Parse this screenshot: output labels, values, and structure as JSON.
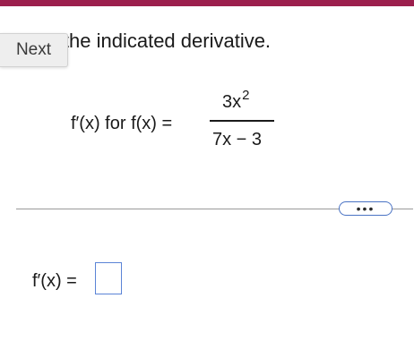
{
  "header": {
    "accent_color": "#9c1f4d"
  },
  "nav": {
    "next_label": "Next"
  },
  "question": {
    "instruction": "Find the indicated derivative.",
    "prompt_text": "f′(x) for f(x) =",
    "numerator_base": "3x",
    "numerator_exponent": "2",
    "denominator": "7x − 3"
  },
  "toolbar": {
    "more_label": "•••"
  },
  "answer": {
    "label": "f′(x) =",
    "value": ""
  }
}
